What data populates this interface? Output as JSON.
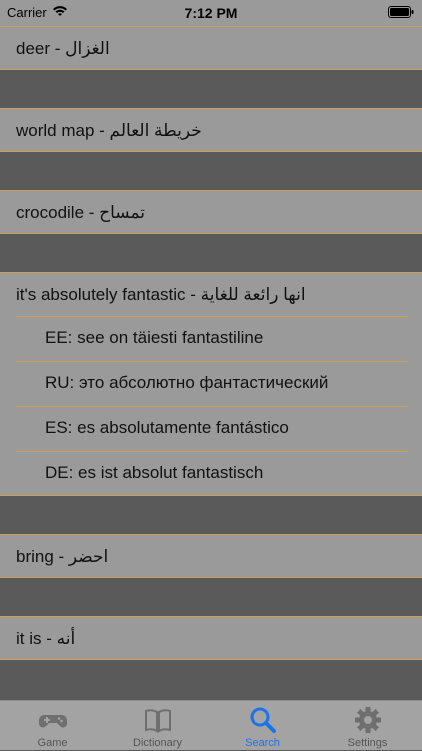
{
  "status_bar": {
    "carrier": "Carrier",
    "time": "7:12 PM"
  },
  "rows": [
    {
      "text": "deer - الغزال"
    },
    {
      "text": "world map - خريطة العالم"
    },
    {
      "text": "crocodile - تمساح"
    },
    {
      "text": "it's absolutely fantastic - انها رائعة للغاية",
      "translations": [
        "EE: see on täiesti fantastiline",
        "RU: это абсолютно фантастический",
        "ES: es absolutamente fantástico",
        "DE: es ist absolut fantastisch"
      ]
    },
    {
      "text": "bring - احضر"
    },
    {
      "text": "it is - أنه"
    }
  ],
  "tabs": [
    {
      "label": "Game",
      "icon": "gamepad-icon"
    },
    {
      "label": "Dictionary",
      "icon": "book-icon"
    },
    {
      "label": "Search",
      "icon": "search-icon",
      "active": true
    },
    {
      "label": "Settings",
      "icon": "gear-icon"
    }
  ],
  "colors": {
    "accent": "#1a73e8",
    "row_bg": "#9a9a9a",
    "gap_bg": "#5a5a5a",
    "separator": "#c9a25a"
  }
}
